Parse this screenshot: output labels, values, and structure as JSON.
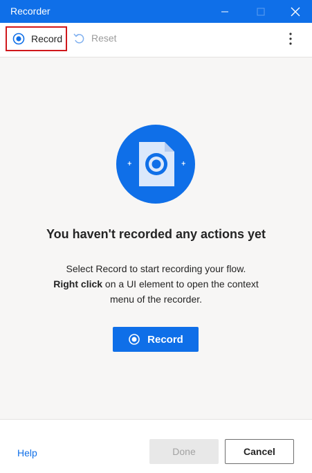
{
  "window": {
    "title": "Recorder",
    "icons": [
      "minimize-icon",
      "maximize-icon",
      "close-icon"
    ]
  },
  "toolbar": {
    "record_label": "Record",
    "reset_label": "Reset",
    "record_icon": "record-icon",
    "reset_icon": "undo-icon",
    "more_icon": "more-vertical-icon"
  },
  "empty_state": {
    "icon": "recording-document-icon",
    "headline": "You haven't recorded any actions yet",
    "line1": "Select Record to start recording your flow.",
    "line2_bold": "Right click",
    "line2_rest": " on a UI element to open the context",
    "line3": "menu of the recorder.",
    "record_button_label": "Record"
  },
  "footer": {
    "help_label": "Help",
    "done_label": "Done",
    "cancel_label": "Cancel"
  },
  "colors": {
    "accent": "#0f6fe8",
    "highlight_border": "#d0171b",
    "disabled_text": "#a2a2a2"
  }
}
